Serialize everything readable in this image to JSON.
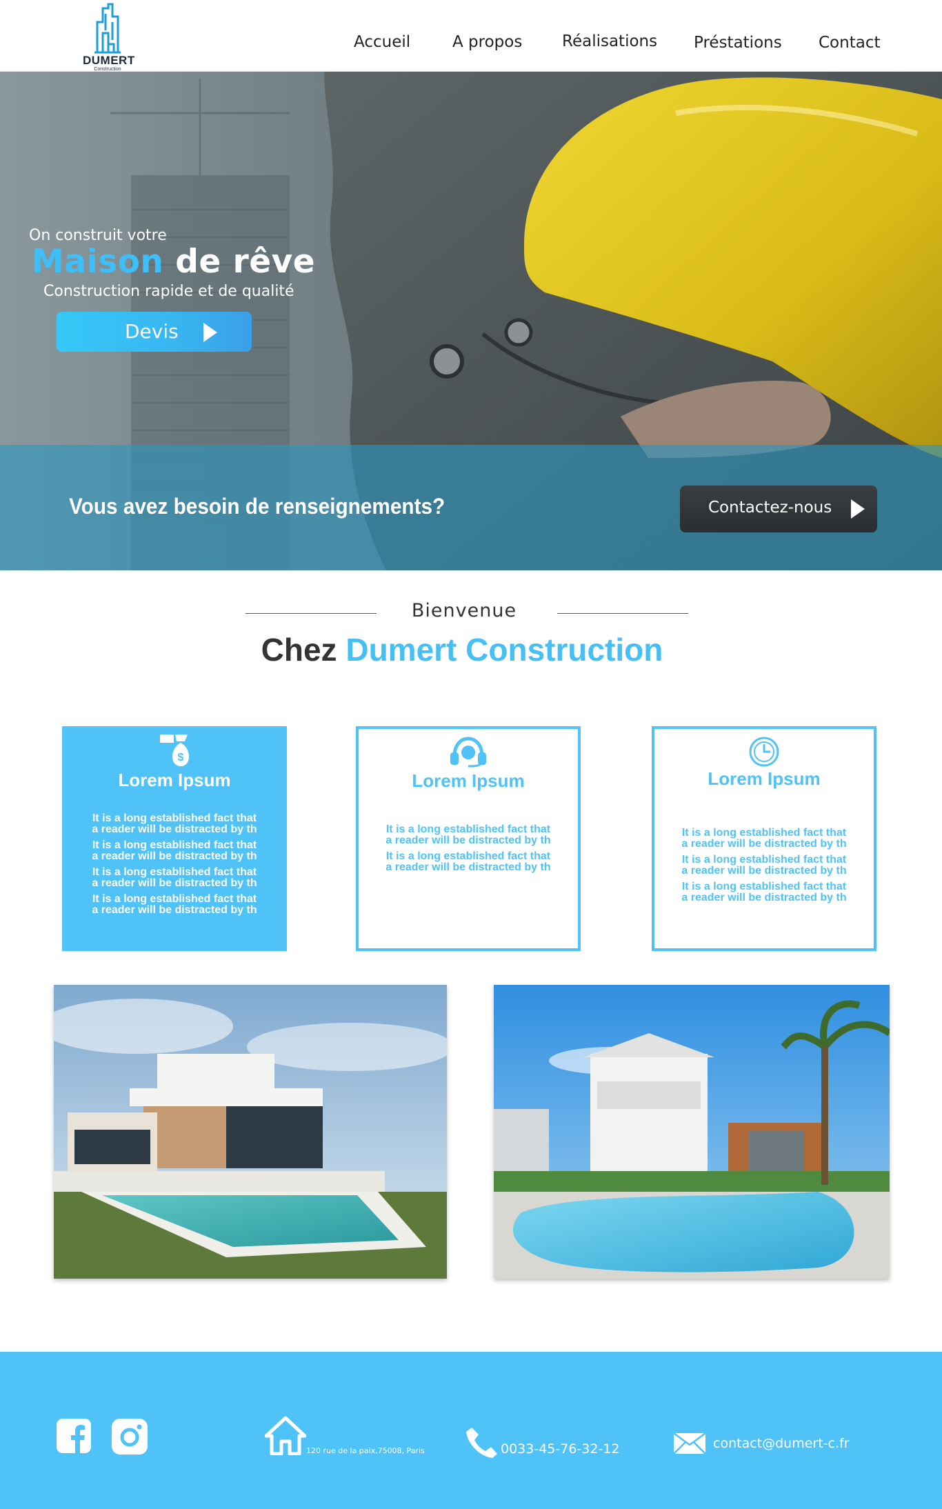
{
  "nav": {
    "logo": {
      "name": "DUMERT",
      "sub": "Construction"
    },
    "items": [
      "Accueil",
      "A propos",
      "Réalisations",
      "Préstations",
      "Contact"
    ]
  },
  "hero": {
    "kicker": "On construit votre",
    "title_accent": "Maison",
    "title_rest": "de rêve",
    "subtitle": "Construction rapide et de qualité",
    "button": "Devis",
    "band_text": "Vous avez besoin de renseignements?",
    "band_button": "Contactez-nous"
  },
  "welcome": {
    "small": "Bienvenue",
    "big_prefix": "Chez",
    "big_accent": "Dumert Construction"
  },
  "cards": [
    {
      "icon": "money-bag-icon",
      "title": "Lorem Ipsum",
      "lines": [
        "It is a long established fact that",
        "a reader will be distracted by th",
        "It is a long established fact that",
        "a reader will be distracted by th",
        "It is a long established fact that",
        "a reader will be distracted by th",
        "It is a long established fact that",
        "a reader will be distracted by th"
      ]
    },
    {
      "icon": "headset-icon",
      "title": "Lorem Ipsum",
      "lines": [
        "It is a long established fact that",
        "a reader will be distracted by th",
        "It is a long established fact that",
        "a reader will be distracted by th"
      ]
    },
    {
      "icon": "clock-icon",
      "title": "Lorem Ipsum",
      "lines": [
        "It is a long established fact that",
        "a reader will be distracted by th",
        "It is a long established fact that",
        "a reader will be distracted by th",
        "It is a long established fact that",
        "a reader will be distracted by th"
      ]
    }
  ],
  "footer": {
    "social": [
      "facebook-icon",
      "instagram-icon"
    ],
    "address": "120 rue de la paix,75008, Paris",
    "phone": "0033-45-76-32-12",
    "email": "contact@dumert-c.fr"
  },
  "colors": {
    "accent": "#4fc3f7",
    "dark": "#333333",
    "button_dark": "#2f3336"
  }
}
